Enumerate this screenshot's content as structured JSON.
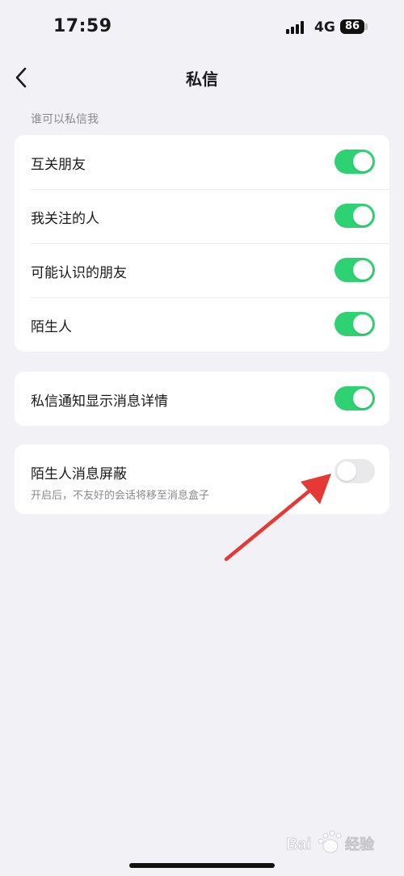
{
  "status_bar": {
    "time": "17:59",
    "network": "4G",
    "battery": "86"
  },
  "nav": {
    "title": "私信",
    "back_icon": "chevron-left-icon"
  },
  "section_header": "谁可以私信我",
  "group1": {
    "rows": [
      {
        "label": "互关朋友",
        "enabled": true
      },
      {
        "label": "我关注的人",
        "enabled": true
      },
      {
        "label": "可能认识的朋友",
        "enabled": true
      },
      {
        "label": "陌生人",
        "enabled": true
      }
    ]
  },
  "group2": {
    "rows": [
      {
        "label": "私信通知显示消息详情",
        "enabled": true
      }
    ]
  },
  "group3": {
    "rows": [
      {
        "label": "陌生人消息屏蔽",
        "subtitle": "开启后，不友好的会话将移至消息盒子",
        "enabled": false
      }
    ]
  },
  "colors": {
    "toggle_on": "#2fd273",
    "toggle_off": "#e9e9ec",
    "annotation_arrow": "#e53935"
  },
  "watermark": {
    "text": "Bai度经验"
  }
}
